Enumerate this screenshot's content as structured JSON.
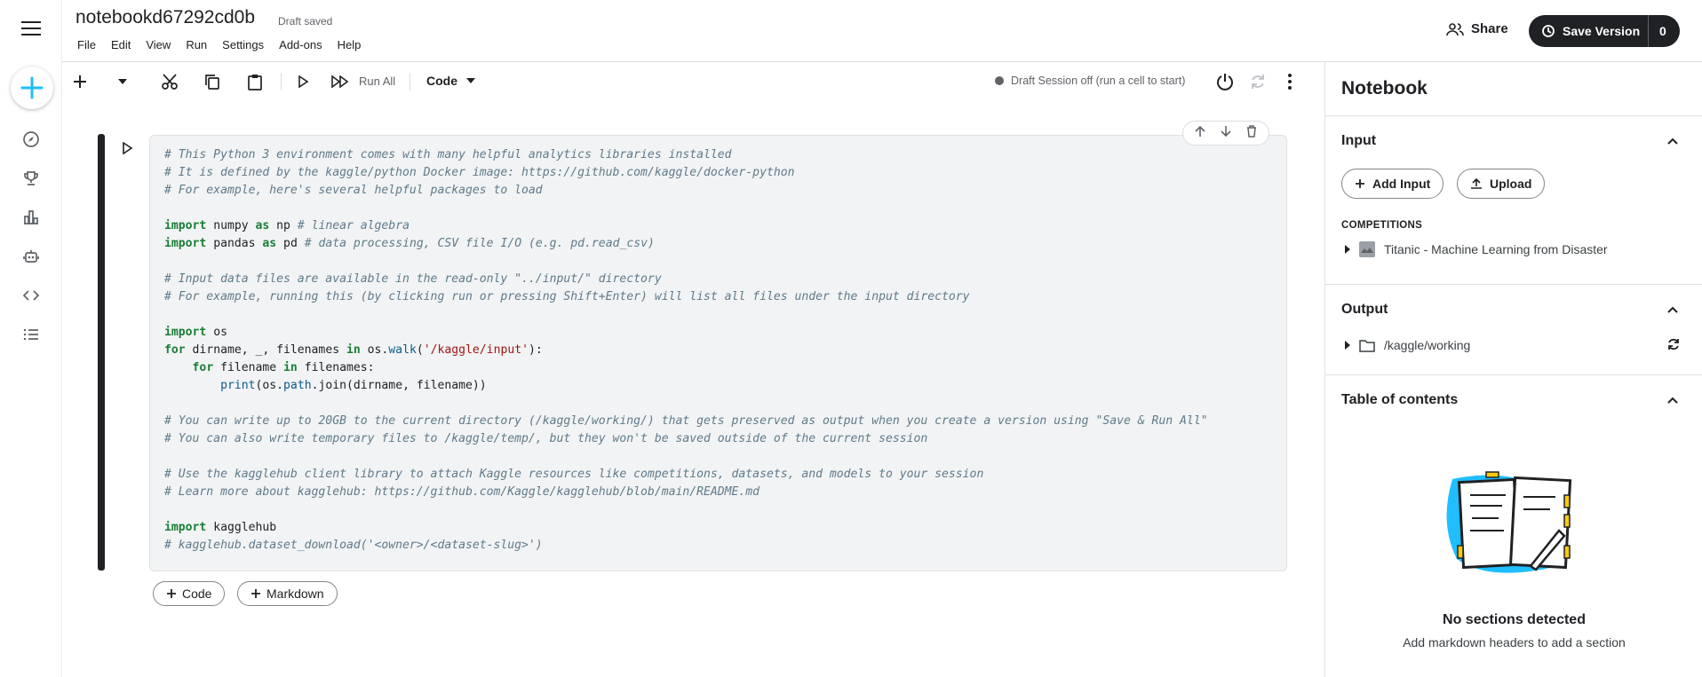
{
  "header": {
    "title": "notebookd67292cd0b",
    "draft_status": "Draft saved",
    "menu": [
      "File",
      "Edit",
      "View",
      "Run",
      "Settings",
      "Add-ons",
      "Help"
    ],
    "share_label": "Share",
    "save_version_label": "Save Version",
    "save_version_count": "0"
  },
  "toolbar": {
    "run_all_label": "Run All",
    "cell_type": "Code",
    "session_status": "Draft Session off (run a cell to start)"
  },
  "cell": {
    "lines": [
      [
        {
          "t": "c",
          "v": "# This Python 3 environment comes with many helpful analytics libraries installed"
        }
      ],
      [
        {
          "t": "c",
          "v": "# It is defined by the kaggle/python Docker image: https://github.com/kaggle/docker-python"
        }
      ],
      [
        {
          "t": "c",
          "v": "# For example, here's several helpful packages to load"
        }
      ],
      [],
      [
        {
          "t": "k",
          "v": "import"
        },
        {
          "t": "p",
          "v": " numpy "
        },
        {
          "t": "k",
          "v": "as"
        },
        {
          "t": "p",
          "v": " np "
        },
        {
          "t": "c",
          "v": "# linear algebra"
        }
      ],
      [
        {
          "t": "k",
          "v": "import"
        },
        {
          "t": "p",
          "v": " pandas "
        },
        {
          "t": "k",
          "v": "as"
        },
        {
          "t": "p",
          "v": " pd "
        },
        {
          "t": "c",
          "v": "# data processing, CSV file I/O (e.g. pd.read_csv)"
        }
      ],
      [],
      [
        {
          "t": "c",
          "v": "# Input data files are available in the read-only \"../input/\" directory"
        }
      ],
      [
        {
          "t": "c",
          "v": "# For example, running this (by clicking run or pressing Shift+Enter) will list all files under the input directory"
        }
      ],
      [],
      [
        {
          "t": "k",
          "v": "import"
        },
        {
          "t": "p",
          "v": " os"
        }
      ],
      [
        {
          "t": "k",
          "v": "for"
        },
        {
          "t": "p",
          "v": " dirname, _, filenames "
        },
        {
          "t": "k",
          "v": "in"
        },
        {
          "t": "p",
          "v": " os."
        },
        {
          "t": "f",
          "v": "walk"
        },
        {
          "t": "p",
          "v": "("
        },
        {
          "t": "s",
          "v": "'/kaggle/input'"
        },
        {
          "t": "p",
          "v": "):"
        }
      ],
      [
        {
          "t": "p",
          "v": "    "
        },
        {
          "t": "k",
          "v": "for"
        },
        {
          "t": "p",
          "v": " filename "
        },
        {
          "t": "k",
          "v": "in"
        },
        {
          "t": "p",
          "v": " filenames:"
        }
      ],
      [
        {
          "t": "p",
          "v": "        "
        },
        {
          "t": "f",
          "v": "print"
        },
        {
          "t": "p",
          "v": "(os."
        },
        {
          "t": "f",
          "v": "path"
        },
        {
          "t": "p",
          "v": ".join(dirname, filename))"
        }
      ],
      [],
      [
        {
          "t": "c",
          "v": "# You can write up to 20GB to the current directory (/kaggle/working/) that gets preserved as output when you create a version using \"Save & Run All\""
        }
      ],
      [
        {
          "t": "c",
          "v": "# You can also write temporary files to /kaggle/temp/, but they won't be saved outside of the current session"
        }
      ],
      [],
      [
        {
          "t": "c",
          "v": "# Use the kagglehub client library to attach Kaggle resources like competitions, datasets, and models to your session"
        }
      ],
      [
        {
          "t": "c",
          "v": "# Learn more about kagglehub: https://github.com/Kaggle/kagglehub/blob/main/README.md"
        }
      ],
      [],
      [
        {
          "t": "k",
          "v": "import"
        },
        {
          "t": "p",
          "v": " kagglehub"
        }
      ],
      [
        {
          "t": "c",
          "v": "# kagglehub.dataset_download('<owner>/<dataset-slug>')"
        }
      ]
    ],
    "add_code_label": "Code",
    "add_markdown_label": "Markdown"
  },
  "panel": {
    "title": "Notebook",
    "input_heading": "Input",
    "add_input_label": "Add Input",
    "upload_label": "Upload",
    "competitions_label": "COMPETITIONS",
    "competition_name": "Titanic - Machine Learning from Disaster",
    "output_heading": "Output",
    "output_path": "/kaggle/working",
    "toc_heading": "Table of contents",
    "no_sections_title": "No sections detected",
    "no_sections_hint": "Add markdown headers to add a section"
  },
  "icons": [
    "menu-icon",
    "plus-icon",
    "compass-icon",
    "trophy-icon",
    "table-icon",
    "robot-icon",
    "code-icon",
    "list-icon",
    "scissors-icon",
    "copy-icon",
    "paste-icon",
    "run-icon",
    "run-all-icon",
    "power-icon",
    "refresh-icon",
    "more-vert-icon",
    "arrow-up-icon",
    "arrow-down-icon",
    "trash-icon",
    "chevron-up-icon",
    "upload-icon",
    "folder-icon",
    "sync-icon"
  ],
  "colors": {
    "accent_blue": "#20beff",
    "dark": "#202124",
    "code_bg": "#f1f3f4"
  }
}
